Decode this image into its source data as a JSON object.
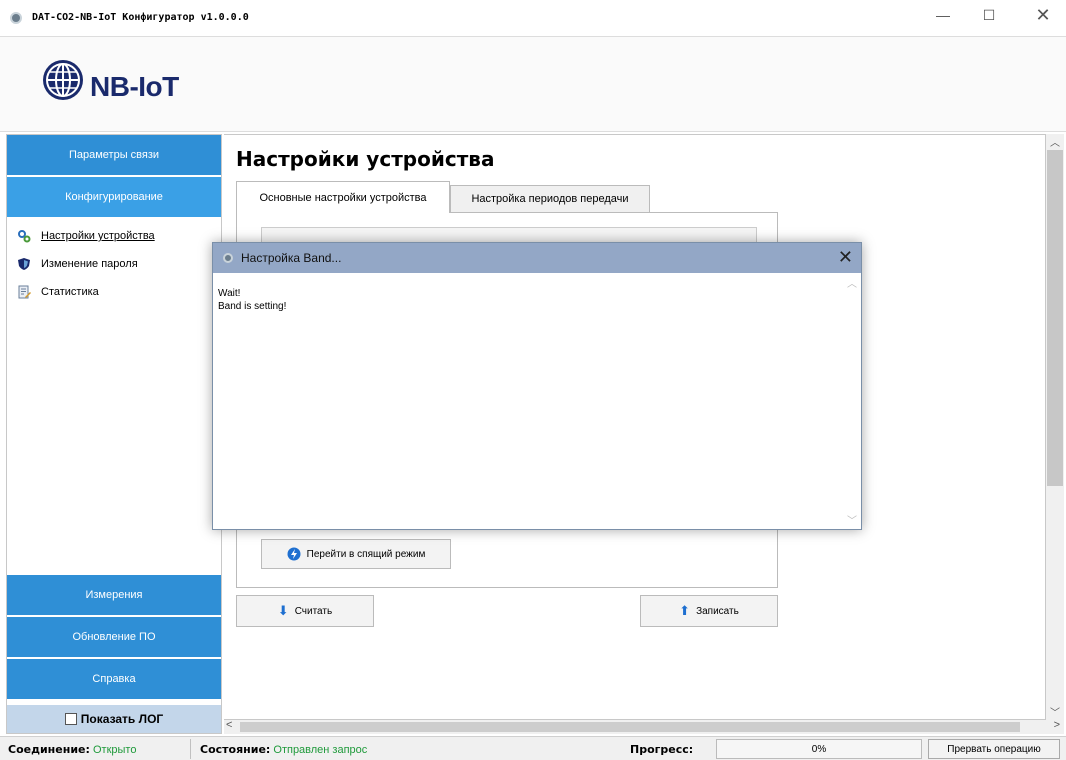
{
  "window": {
    "title": "DAT-CO2-NB-IoT Конфигуратор v1.0.0.0"
  },
  "logo": {
    "text": "NB-IoT"
  },
  "sidebar": {
    "comm_params": "Параметры связи",
    "configuring": "Конфигурирование",
    "sub_items": [
      "Настройки устройства",
      "Изменение пароля",
      "Статистика"
    ],
    "measurements": "Измерения",
    "firmware_update": "Обновление ПО",
    "help": "Справка",
    "show_log": "Показать ЛОГ"
  },
  "main": {
    "title": "Настройки устройства",
    "tabs": [
      "Основные настройки устройства",
      "Настройка периодов передачи"
    ],
    "sleep_button": "Перейти в спящий режим",
    "read_button": "Считать",
    "write_button": "Записать"
  },
  "dialog": {
    "title": "Настройка Band...",
    "lines": [
      "Wait!",
      "Band is setting!"
    ]
  },
  "status": {
    "connection_label": "Соединение:",
    "connection_value": "Открыто",
    "state_label": "Состояние:",
    "state_value": "Отправлен запрос",
    "progress_label": "Прогресс:",
    "progress_value": "0%",
    "abort_button": "Прервать операцию"
  },
  "colors": {
    "sidebar_blue": "#2f8fd6",
    "sidebar_active": "#3aa0e6",
    "status_green": "#1f9a3b"
  }
}
